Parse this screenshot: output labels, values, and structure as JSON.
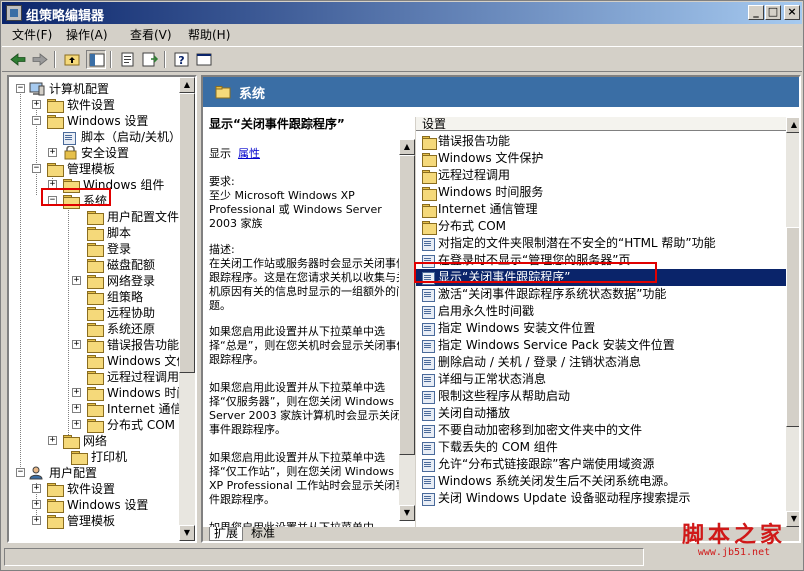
{
  "window": {
    "title": "组策略编辑器"
  },
  "title_buttons": {
    "minimize": "_",
    "maximize": "□",
    "close": "×"
  },
  "menu": [
    {
      "label": "文件(F)"
    },
    {
      "label": "操作(A)"
    },
    {
      "label": "查看(V)"
    },
    {
      "label": "帮助(H)"
    }
  ],
  "toolbar": [
    "back-icon",
    "forward-icon",
    "up-folder-icon",
    "show-tree-icon",
    "properties-icon",
    "export-list-icon",
    "help-icon",
    "console-icon"
  ],
  "tree": {
    "computer_config": "计算机配置",
    "software_settings": "软件设置",
    "windows_settings": "Windows 设置",
    "scripts": "脚本（启动/关机）",
    "security_settings": "安全设置",
    "admin_templates": "管理模板",
    "windows_components": "Windows 组件",
    "system": "系统",
    "system_children": [
      "用户配置文件",
      "脚本",
      "登录",
      "磁盘配额",
      "网络登录",
      "组策略",
      "远程协助",
      "系统还原",
      "错误报告功能",
      "Windows 文件保护",
      "远程过程调用",
      "Windows 时间服务",
      "Internet 通信管理",
      "分布式 COM"
    ],
    "network": "网络",
    "printers": "打印机",
    "user_config": "用户配置",
    "user_software_settings": "软件设置",
    "user_windows_settings": "Windows 设置",
    "user_admin_templates": "管理模板"
  },
  "right": {
    "header_title": "系统",
    "description": {
      "title": "显示“关闭事件跟踪程序”",
      "show_label": "显示",
      "properties_link": "属性",
      "requirements_label": "要求:",
      "requirements_text": "至少 Microsoft Windows XP Professional 或 Windows Server 2003 家族",
      "desc_label": "描述:",
      "desc_p1": "在关闭工作站或服务器时会显示关闭事件跟踪程序。这是在您请求关机以收集与关机原因有关的信息时显示的一组额外的问题。",
      "desc_p2": "如果您启用此设置并从下拉菜单中选择“总是”，则在您关机时会显示关闭事件跟踪程序。",
      "desc_p3": "如果您启用此设置并从下拉菜单中选择“仅服务器”，则在您关闭 Windows Server 2003 家族计算机时会显示关闭事件跟踪程序。",
      "desc_p4": "如果您启用此设置并从下拉菜单中选择“仅工作站”，则在您关闭 Windows XP Professional 工作站时会显示关闭事件跟踪程序。",
      "desc_p5": "如果您启用此设置并从下拉菜单中"
    },
    "list_header": "设置",
    "list_rows": [
      {
        "label": "错误报告功能",
        "kind": "folder"
      },
      {
        "label": "Windows 文件保护",
        "kind": "folder"
      },
      {
        "label": "远程过程调用",
        "kind": "folder"
      },
      {
        "label": "Windows 时间服务",
        "kind": "folder"
      },
      {
        "label": "Internet 通信管理",
        "kind": "folder"
      },
      {
        "label": "分布式 COM",
        "kind": "folder"
      },
      {
        "label": "对指定的文件夹限制潜在不安全的“HTML 帮助”功能",
        "kind": "setting"
      },
      {
        "label": "在登录时不显示“管理您的服务器”页",
        "kind": "setting"
      },
      {
        "label": "显示“关闭事件跟踪程序”",
        "kind": "setting",
        "selected": true
      },
      {
        "label": "激活“关闭事件跟踪程序系统状态数据”功能",
        "kind": "setting"
      },
      {
        "label": "启用永久性时间戳",
        "kind": "setting"
      },
      {
        "label": "指定 Windows 安装文件位置",
        "kind": "setting"
      },
      {
        "label": "指定 Windows Service Pack 安装文件位置",
        "kind": "setting"
      },
      {
        "label": "删除启动 / 关机 / 登录 / 注销状态消息",
        "kind": "setting"
      },
      {
        "label": "详细与正常状态消息",
        "kind": "setting"
      },
      {
        "label": "限制这些程序从帮助启动",
        "kind": "setting"
      },
      {
        "label": "关闭自动播放",
        "kind": "setting"
      },
      {
        "label": "不要自动加密移到加密文件夹中的文件",
        "kind": "setting"
      },
      {
        "label": "下载丢失的 COM 组件",
        "kind": "setting"
      },
      {
        "label": "允许“分布式链接跟踪”客户端使用域资源",
        "kind": "setting"
      },
      {
        "label": "Windows 系统关闭发生后不关闭系统电源。",
        "kind": "setting"
      },
      {
        "label": "关闭 Windows Update 设备驱动程序搜索提示",
        "kind": "setting"
      }
    ],
    "tabs": [
      "扩展",
      "标准"
    ]
  },
  "watermark": {
    "main": "脚本之家",
    "sub": "www.jb51.net"
  },
  "colors": {
    "selection": "#0a246a",
    "title_start": "#0a246a",
    "highlight_box": "#e00000",
    "header_band": "#3a6ea5"
  }
}
